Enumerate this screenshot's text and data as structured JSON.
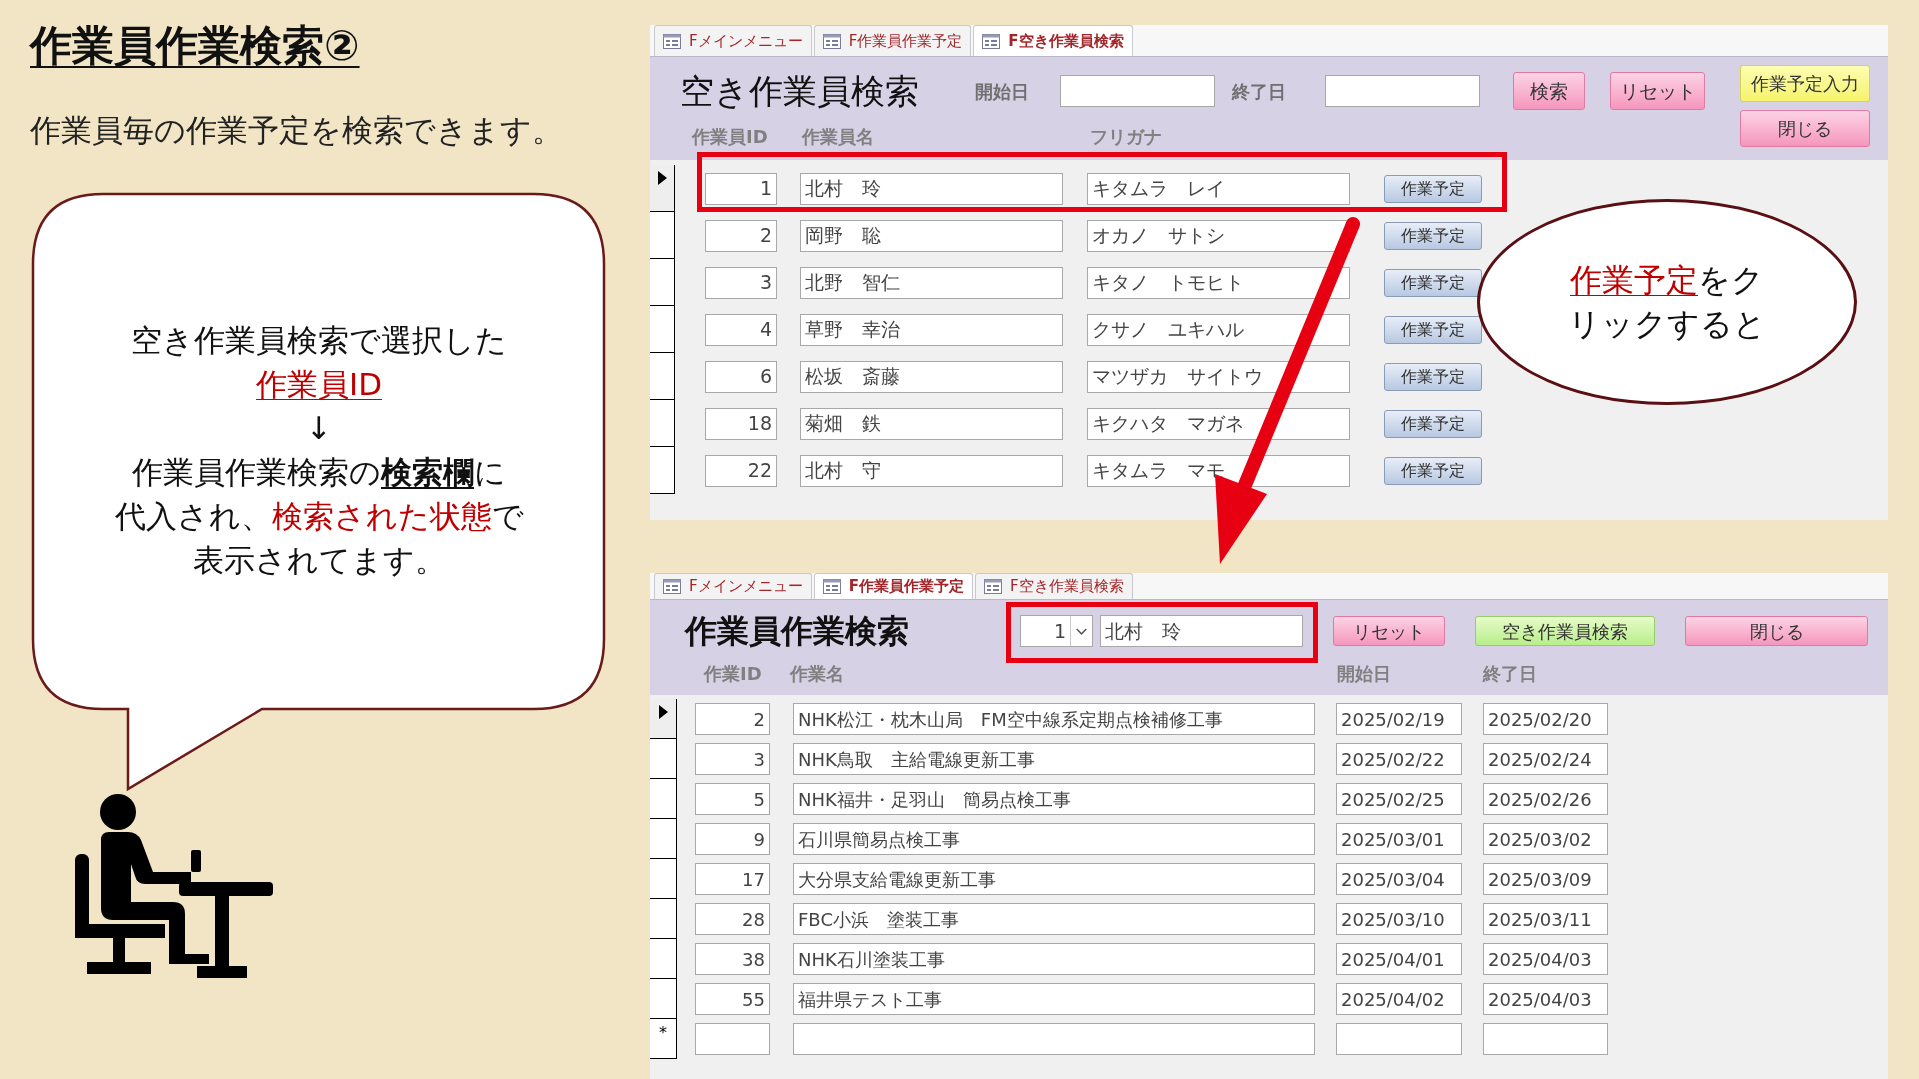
{
  "slide": {
    "title": "作業員作業検索②",
    "subtitle": "作業員毎の作業予定を検索できます。"
  },
  "speech_bubble": {
    "lines": [
      [
        {
          "text": "空き作業員検索で選択した",
          "kind": "plain"
        }
      ],
      [
        {
          "text": "作業員ID",
          "kind": "red_underline"
        }
      ],
      [
        {
          "text": "↓",
          "kind": "plain"
        }
      ],
      [
        {
          "text": "作業員作業検索の",
          "kind": "plain"
        },
        {
          "text": "検索欄",
          "kind": "bold_underline"
        },
        {
          "text": "に",
          "kind": "plain"
        }
      ],
      [
        {
          "text": "代入され、",
          "kind": "plain"
        },
        {
          "text": "検索された状態",
          "kind": "red"
        },
        {
          "text": "で",
          "kind": "plain"
        }
      ],
      [
        {
          "text": "表示されてます。",
          "kind": "plain"
        }
      ]
    ]
  },
  "callout": {
    "lines": [
      [
        {
          "text": "作業予定",
          "kind": "red_underline"
        },
        {
          "text": "をク",
          "kind": "plain"
        }
      ],
      [
        {
          "text": "リックすると",
          "kind": "plain"
        }
      ]
    ]
  },
  "top_window": {
    "tabs": [
      {
        "label": "Fメインメニュー",
        "selected": false
      },
      {
        "label": "F作業員作業予定",
        "selected": false
      },
      {
        "label": "F空き作業員検索",
        "selected": true
      }
    ],
    "title": "空き作業員検索",
    "start_label": "開始日",
    "end_label": "終了日",
    "buttons": [
      {
        "label": "検索",
        "kind": "pink"
      },
      {
        "label": "リセット",
        "kind": "pink"
      }
    ],
    "side_buttons": [
      {
        "label": "作業予定入力",
        "kind": "yellow"
      },
      {
        "label": "閉じる",
        "kind": "pink"
      }
    ],
    "columns": [
      "作業員ID",
      "作業員名",
      "フリガナ"
    ],
    "rows": [
      {
        "id": "1",
        "name": "北村　玲",
        "kana": "キタムラ　レイ",
        "button": "作業予定",
        "selected": true
      },
      {
        "id": "2",
        "name": "岡野　聡",
        "kana": "オカノ　サトシ",
        "button": "作業予定",
        "selected": false
      },
      {
        "id": "3",
        "name": "北野　智仁",
        "kana": "キタノ　トモヒト",
        "button": "作業予定",
        "selected": false
      },
      {
        "id": "4",
        "name": "草野　幸治",
        "kana": "クサノ　ユキハル",
        "button": "作業予定",
        "selected": false
      },
      {
        "id": "6",
        "name": "松坂　斎藤",
        "kana": "マツザカ　サイトウ",
        "button": "作業予定",
        "selected": false
      },
      {
        "id": "18",
        "name": "菊畑　鉄",
        "kana": "キクハタ　マガネ",
        "button": "作業予定",
        "selected": false
      },
      {
        "id": "22",
        "name": "北村　守",
        "kana": "キタムラ　マモ",
        "button": "作業予定",
        "selected": false
      }
    ]
  },
  "bottom_window": {
    "tabs": [
      {
        "label": "Fメインメニュー",
        "selected": false
      },
      {
        "label": "F作業員作業予定",
        "selected": true
      },
      {
        "label": "F空き作業員検索",
        "selected": false
      }
    ],
    "title": "作業員作業検索",
    "worker_id": "1",
    "worker_name": "北村　玲",
    "buttons": [
      {
        "label": "リセット",
        "kind": "pink"
      },
      {
        "label": "空き作業員検索",
        "kind": "green"
      },
      {
        "label": "閉じる",
        "kind": "pink"
      }
    ],
    "columns": [
      "作業ID",
      "作業名",
      "開始日",
      "終了日"
    ],
    "rows": [
      {
        "id": "2",
        "name": "NHK松江・枕木山局　FM空中線系定期点検補修工事",
        "start": "2025/02/19",
        "end": "2025/02/20",
        "selected": true
      },
      {
        "id": "3",
        "name": "NHK鳥取　主給電線更新工事",
        "start": "2025/02/22",
        "end": "2025/02/24",
        "selected": false
      },
      {
        "id": "5",
        "name": "NHK福井・足羽山　簡易点検工事",
        "start": "2025/02/25",
        "end": "2025/02/26",
        "selected": false
      },
      {
        "id": "9",
        "name": "石川県簡易点検工事",
        "start": "2025/03/01",
        "end": "2025/03/02",
        "selected": false
      },
      {
        "id": "17",
        "name": "大分県支給電線更新工事",
        "start": "2025/03/04",
        "end": "2025/03/09",
        "selected": false
      },
      {
        "id": "28",
        "name": "FBC小浜　塗装工事",
        "start": "2025/03/10",
        "end": "2025/03/11",
        "selected": false
      },
      {
        "id": "38",
        "name": "NHK石川塗装工事",
        "start": "2025/04/01",
        "end": "2025/04/03",
        "selected": false
      },
      {
        "id": "55",
        "name": "福井県テスト工事",
        "start": "2025/04/02",
        "end": "2025/04/03",
        "selected": false
      }
    ],
    "new_row_marker": "*"
  }
}
